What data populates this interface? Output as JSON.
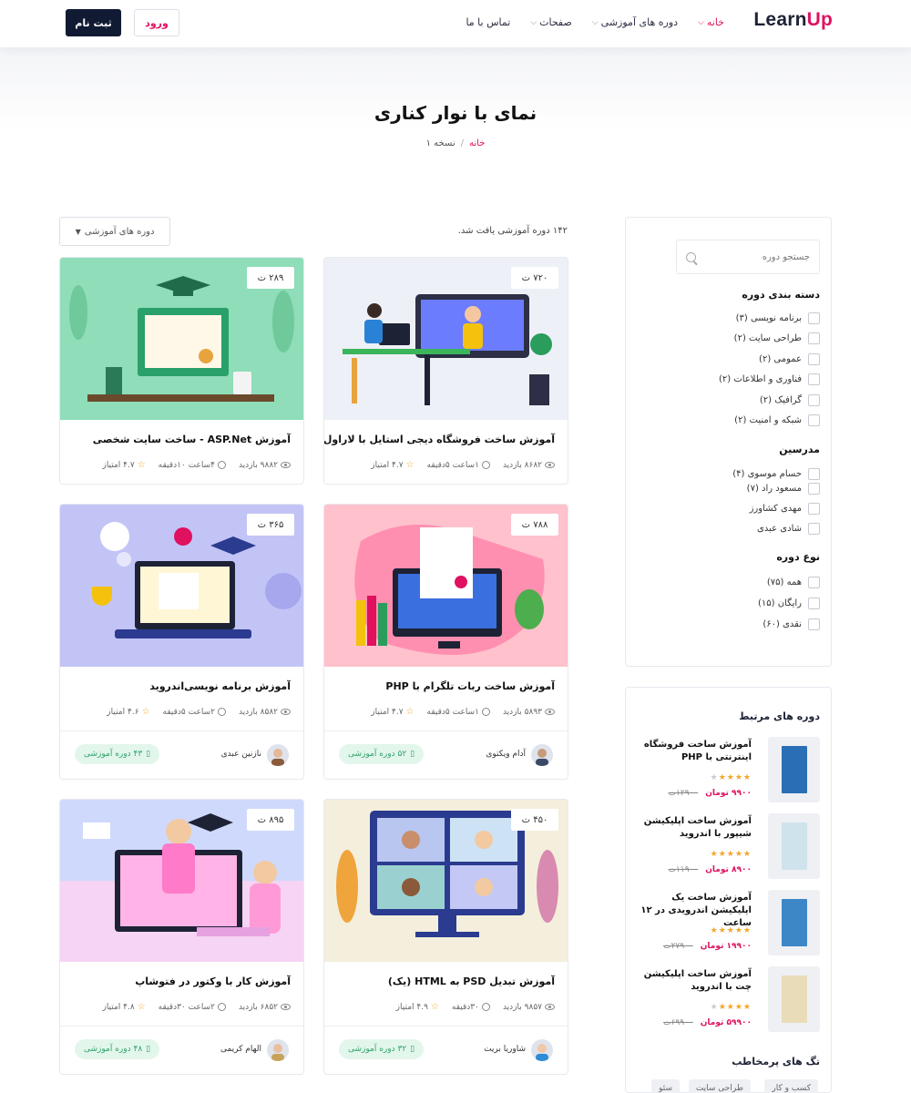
{
  "header": {
    "logo": {
      "part1": "Learn",
      "part2": "Up"
    },
    "nav": [
      {
        "label": "خانه",
        "active": true,
        "dropdown": true
      },
      {
        "label": "دوره های آموزشی",
        "active": false,
        "dropdown": true
      },
      {
        "label": "صفحات",
        "active": false,
        "dropdown": true
      },
      {
        "label": "تماس با ما",
        "active": false,
        "dropdown": false
      }
    ],
    "login_label": "ورود",
    "register_label": "ثبت نام"
  },
  "hero": {
    "title": "نمای با نوار کناری",
    "breadcrumb": {
      "home": "خانه",
      "separator": "/",
      "current": "نسخه ۱"
    }
  },
  "sidebar": {
    "search_placeholder": "جستجو دوره",
    "categories": {
      "title": "دسته بندی دوره",
      "items": [
        "برنامه نویسی (۳)",
        "طراحی سایت (۲)",
        "عمومی (۲)",
        "فناوری و اطلاعات (۲)",
        "گرافیک (۲)",
        "شبکه و امنیت (۲)"
      ]
    },
    "instructors": {
      "title": "مدرسین",
      "items": [
        "حسام موسوی (۴)",
        "مسعود راد (۷)",
        "مهدی کشاورز",
        "شادی عبدی"
      ]
    },
    "type": {
      "title": "نوع دوره",
      "items": [
        "همه (۷۵)",
        "رایگان (۱۵)",
        "نقدی (۶۰)"
      ]
    },
    "related": {
      "title": "دوره های مرتبط",
      "items": [
        {
          "name": "آموزش ساخت فروشگاه اینترنتی با PHP",
          "rating": 4,
          "price": "۹۹۰۰ تومان",
          "old_price": "۱۲۹۰۰ت",
          "cover": "#2a6fb5"
        },
        {
          "name": "آموزش ساخت اپلیکیشن شیپور با اندروید",
          "rating": 5,
          "price": "۸۹۰۰ تومان",
          "old_price": "۱۱۹۰۰ت",
          "cover": "#cfe3ec"
        },
        {
          "name": "آموزش ساخت یک اپلیکیشن اندرویدی در ۱۲ ساعت",
          "rating": 5,
          "price": "۱۹۹۰۰ تومان",
          "old_price": "۲۷۹۰۰ت",
          "cover": "#3d87c7"
        },
        {
          "name": "آموزش ساخت اپلیکیشن چت با اندروید",
          "rating": 4,
          "price": "۵۹۹۰۰ تومان",
          "old_price": "۶۹۹۰۰ت",
          "cover": "#e9dcb8"
        }
      ]
    },
    "tags": {
      "title": "تگ های پرمخاطب",
      "items": [
        "کسب و کار",
        "طراحی سایت",
        "سئو"
      ]
    }
  },
  "listing": {
    "found_text": "۱۴۲ دوره آموزشی یافت شد.",
    "sort_label": "دوره های آموزشی"
  },
  "courses": [
    {
      "title": "آموزش ساخت فروشگاه دیجی استایل با لاراول",
      "price": "۷۲۰ ت",
      "views": "۸۶۸۲ بازدید",
      "duration": "۱ساعت ۵دقیقه",
      "rating": "۴.۷ امتیاز",
      "bg": "#eef0f7"
    },
    {
      "title": "آموزش ASP.Net - ساخت سایت شخصی",
      "price": "۲۸۹ ت",
      "views": "۹۸۸۲ بازدید",
      "duration": "۴ساعت ۱۰دقیقه",
      "rating": "۴.۷ امتیاز",
      "bg": "#8fddb9"
    },
    {
      "title": "آموزش ساخت ربات تلگرام با PHP",
      "price": "۷۸۸ ت",
      "views": "۵۸۹۳ بازدید",
      "duration": "۱ساعت ۵دقیقه",
      "rating": "۴.۷ امتیاز",
      "bg": "#ffc1cc",
      "author": "آدام ویکتوی",
      "author_courses": "۵۲ دوره آموزشی"
    },
    {
      "title": "آموزش برنامه نویسی‌اندروید",
      "price": "۳۶۵ ت",
      "views": "۸۵۸۲ بازدید",
      "duration": "۲ساعت ۵دقیقه",
      "rating": "۴.۶ امتیاز",
      "bg": "#c3c4f6",
      "author": "نازنین عبدی",
      "author_courses": "۴۳ دوره آموزشی"
    },
    {
      "title": "آموزش تبدیل PSD به HTML (یک)",
      "price": "۴۵۰ ت",
      "views": "۹۸۵۷ بازدید",
      "duration": "۳۰دقیقه",
      "rating": "۴.۹ امتیاز",
      "bg": "#f4efdc",
      "author": "شاوریا بریت",
      "author_courses": "۳۲ دوره آموزشی"
    },
    {
      "title": "آموزش کار با وکتور در فتوشاپ",
      "price": "۸۹۵ ت",
      "views": "۶۸۵۲ بازدید",
      "duration": "۲ساعت ۳۰دقیقه",
      "rating": "۴.۸ امتیاز",
      "bg": "#f5d4f5",
      "author": "الهام کریمی",
      "author_courses": "۴۸ دوره آموزشی"
    }
  ]
}
